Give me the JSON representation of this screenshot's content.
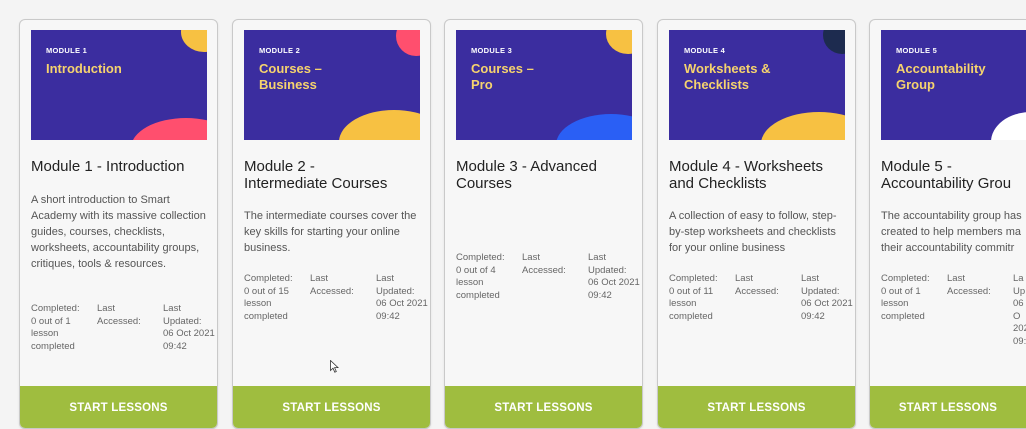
{
  "colors": {
    "thumbnail_bg": "#3b2d9f",
    "thumbnail_title": "#f6d36e",
    "button_bg": "#9fbd3f",
    "button_text": "#ffffff",
    "accent_yellow": "#f7c142",
    "accent_pink": "#ff4f6e",
    "accent_blue": "#2a5ff5"
  },
  "modules": [
    {
      "thumb_label": "MODULE 1",
      "thumb_title": "Introduction",
      "title": "Module 1 - Introduction",
      "description": "A short introduction to Smart Academy with its massive collection guides, courses, checklists, worksheets, accountability groups, critiques, tools & resources.",
      "completed_label": "Completed:",
      "completed_value": "0 out of 1 lesson completed",
      "last_accessed_label": "Last Accessed:",
      "last_accessed_value": "",
      "last_updated_label": "Last Updated:",
      "last_updated_value": "06 Oct 2021 09:42",
      "button_label": "START LESSONS"
    },
    {
      "thumb_label": "MODULE 2",
      "thumb_title": "Courses –\nBusiness",
      "title": "Module 2 -\nIntermediate Courses",
      "description": "The intermediate courses cover the key skills for starting your online business.",
      "completed_label": "Completed:",
      "completed_value": "0 out of 15 lesson completed",
      "last_accessed_label": "Last Accessed:",
      "last_accessed_value": "",
      "last_updated_label": "Last Updated:",
      "last_updated_value": "06 Oct 2021 09:42",
      "button_label": "START LESSONS"
    },
    {
      "thumb_label": "MODULE 3",
      "thumb_title": "Courses –\nPro",
      "title": "Module 3 - Advanced\nCourses",
      "description": "",
      "completed_label": "Completed:",
      "completed_value": "0 out of 4 lesson completed",
      "last_accessed_label": "Last Accessed:",
      "last_accessed_value": "",
      "last_updated_label": "Last Updated:",
      "last_updated_value": "06 Oct 2021 09:42",
      "button_label": "START LESSONS"
    },
    {
      "thumb_label": "MODULE 4",
      "thumb_title": "Worksheets &\nChecklists",
      "title": "Module 4 - Worksheets\nand Checklists",
      "description": "A collection of easy to follow, step-by-step worksheets and checklists for your online business",
      "completed_label": "Completed:",
      "completed_value": "0 out of 11 lesson completed",
      "last_accessed_label": "Last Accessed:",
      "last_accessed_value": "",
      "last_updated_label": "Last Updated:",
      "last_updated_value": "06 Oct 2021 09:42",
      "button_label": "START LESSONS"
    },
    {
      "thumb_label": "MODULE 5",
      "thumb_title": "Accountability\nGroup",
      "title": "Module 5 -\nAccountability Grou",
      "description": "The accountability group has created to help members ma their accountability commitr",
      "completed_label": "Completed:",
      "completed_value": "0 out of 1 lesson completed",
      "last_accessed_label": "Last Accessed:",
      "last_accessed_value": "",
      "last_updated_label": "La Up",
      "last_updated_value": "06 O 2021 09:4",
      "button_label": "START LESSONS"
    }
  ]
}
